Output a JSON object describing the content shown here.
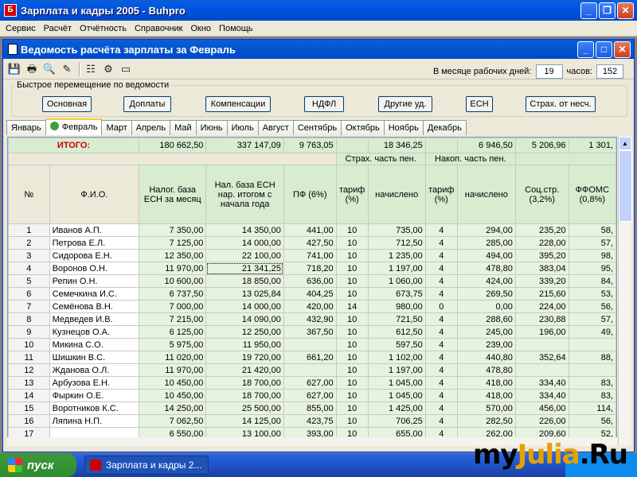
{
  "window": {
    "title": "Зарплата и кадры 2005 - Buhpro",
    "icon": "app-icon",
    "minimize": "_",
    "maximize": "❐",
    "close": "✕"
  },
  "menu": [
    "Сервис",
    "Расчёт",
    "Отчётность",
    "Справочник",
    "Окно",
    "Помощь"
  ],
  "child": {
    "title": "Ведомость расчёта зарплаты за Февраль",
    "minimize": "_",
    "maximize": "□",
    "close": "✕"
  },
  "toolbar": {
    "icons": [
      "save-icon",
      "print-icon",
      "find-icon",
      "edit-icon",
      "properties-icon",
      "settings-icon",
      "monitor-icon"
    ],
    "work_days_label": "В месяце рабочих дней:",
    "work_days": "19",
    "hours_label": "часов:",
    "hours": "152"
  },
  "quick_nav": {
    "legend": "Быстрое перемещение по ведомости",
    "buttons": [
      "Основная",
      "Доплаты",
      "Компенсации",
      "НДФЛ",
      "Другие уд.",
      "ЕСН",
      "Страх. от несч."
    ]
  },
  "tabs": [
    "Январь",
    "Февраль",
    "Март",
    "Апрель",
    "Май",
    "Июнь",
    "Июль",
    "Август",
    "Сентябрь",
    "Октябрь",
    "Ноябрь",
    "Декабрь"
  ],
  "active_tab": "Февраль",
  "totals": {
    "label": "ИТОГО:",
    "values": [
      "180 662,50",
      "337 147,09",
      "9 763,05",
      "",
      "18 346,25",
      "",
      "6 946,50",
      "5 206,96",
      "1 301,"
    ]
  },
  "group_headers": {
    "strakh": "Страх. часть пен.",
    "nakop": "Накоп. часть пен."
  },
  "headers": [
    "№",
    "Ф.И.О.",
    "Налог. база ЕСН за месяц",
    "Нал. база ЕСН нар. итогом с начала года",
    "ПФ (6%)",
    "тариф (%)",
    "начислено",
    "тариф (%)",
    "начислено",
    "Соц.стр. (3,2%)",
    "ФФОМС (0,8%)"
  ],
  "rows": [
    [
      "1",
      "Иванов А.П.",
      "7 350,00",
      "14 350,00",
      "441,00",
      "10",
      "735,00",
      "4",
      "294,00",
      "235,20",
      "58,"
    ],
    [
      "2",
      "Петрова Е.Л.",
      "7 125,00",
      "14 000,00",
      "427,50",
      "10",
      "712,50",
      "4",
      "285,00",
      "228,00",
      "57,"
    ],
    [
      "3",
      "Сидорова Е.Н.",
      "12 350,00",
      "22 100,00",
      "741,00",
      "10",
      "1 235,00",
      "4",
      "494,00",
      "395,20",
      "98,"
    ],
    [
      "4",
      "Воронов О.Н.",
      "11 970,00",
      "21 341,25",
      "718,20",
      "10",
      "1 197,00",
      "4",
      "478,80",
      "383,04",
      "95,"
    ],
    [
      "5",
      "Репин О.Н.",
      "10 600,00",
      "18 850,00",
      "636,00",
      "10",
      "1 060,00",
      "4",
      "424,00",
      "339,20",
      "84,"
    ],
    [
      "6",
      "Семечкина И.С.",
      "6 737,50",
      "13 025,84",
      "404,25",
      "10",
      "673,75",
      "4",
      "269,50",
      "215,60",
      "53,"
    ],
    [
      "7",
      "Семёнова В.Н.",
      "7 000,00",
      "14 000,00",
      "420,00",
      "14",
      "980,00",
      "0",
      "0,00",
      "224,00",
      "56,"
    ],
    [
      "8",
      "Медведев И.В.",
      "7 215,00",
      "14 090,00",
      "432,90",
      "10",
      "721,50",
      "4",
      "288,60",
      "230,88",
      "57,"
    ],
    [
      "9",
      "Кузнецов О.А.",
      "6 125,00",
      "12 250,00",
      "367,50",
      "10",
      "612,50",
      "4",
      "245,00",
      "196,00",
      "49,"
    ],
    [
      "10",
      "Микина С.О.",
      "5 975,00",
      "11 950,00",
      "",
      "10",
      "597,50",
      "4",
      "239,00",
      "",
      ""
    ],
    [
      "11",
      "Шишкин В.С.",
      "11 020,00",
      "19 720,00",
      "661,20",
      "10",
      "1 102,00",
      "4",
      "440,80",
      "352,64",
      "88,"
    ],
    [
      "12",
      "Жданова О.Л.",
      "11 970,00",
      "21 420,00",
      "",
      "10",
      "1 197,00",
      "4",
      "478,80",
      "",
      ""
    ],
    [
      "13",
      "Арбузова Е.Н.",
      "10 450,00",
      "18 700,00",
      "627,00",
      "10",
      "1 045,00",
      "4",
      "418,00",
      "334,40",
      "83,"
    ],
    [
      "14",
      "Фыркин О.Е.",
      "10 450,00",
      "18 700,00",
      "627,00",
      "10",
      "1 045,00",
      "4",
      "418,00",
      "334,40",
      "83,"
    ],
    [
      "15",
      "Воротников К.С.",
      "14 250,00",
      "25 500,00",
      "855,00",
      "10",
      "1 425,00",
      "4",
      "570,00",
      "456,00",
      "114,"
    ],
    [
      "16",
      "Ляпина Н.П.",
      "7 062,50",
      "14 125,00",
      "423,75",
      "10",
      "706,25",
      "4",
      "282,50",
      "226,00",
      "56,"
    ],
    [
      "17",
      "",
      "6 550,00",
      "13 100,00",
      "393,00",
      "10",
      "655,00",
      "4",
      "262,00",
      "209,60",
      "52,"
    ]
  ],
  "taskbar": {
    "start": "пуск",
    "task": "Зарплата и кадры 2..."
  },
  "watermark": {
    "a": "my",
    "b": "Julia",
    "c": ".Ru"
  }
}
